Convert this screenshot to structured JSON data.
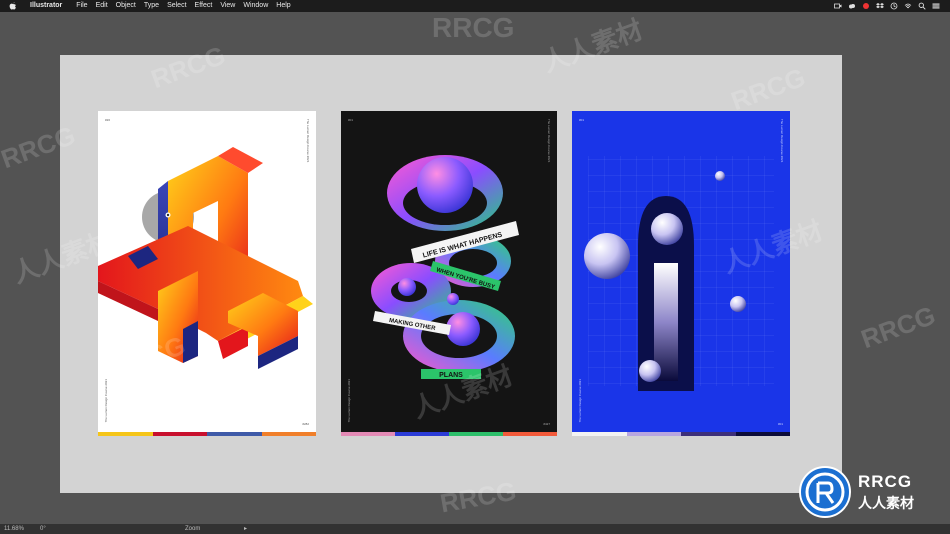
{
  "menubar": {
    "app": "Illustrator",
    "items": [
      "File",
      "Edit",
      "Object",
      "Type",
      "Select",
      "Effect",
      "View",
      "Window",
      "Help"
    ]
  },
  "posters": [
    {
      "number": "#26",
      "number_bottom": "#282",
      "side_text": "The Lumen Design Course 2021",
      "strip_colors": [
        "#f5c518",
        "#c8102e",
        "#3e5aa8",
        "#f07f2a"
      ]
    },
    {
      "number": "#01",
      "number_bottom": "#427",
      "side_text": "The Lumen Design Course 2021",
      "lines": [
        "LIFE IS WHAT HAPPENS",
        "WHEN YOU'RE BUSY",
        "MAKING OTHER",
        "PLANS"
      ],
      "strip_colors": [
        "#e38ab5",
        "#2a3bd6",
        "#2dbf6a",
        "#f25a3a"
      ]
    },
    {
      "number": "#01",
      "number_bottom": "#01",
      "side_text": "The Lumen Design Course 2021",
      "strip_colors": [
        "#f2f2f2",
        "#b7a6e0",
        "#3d2f7a",
        "#0c0c3a"
      ]
    }
  ],
  "statusbar": {
    "zoom": "11.68%",
    "rotation": "0°",
    "tool": "Zoom"
  },
  "watermark": {
    "text_en": "RRCG",
    "text_cn": "人人素材"
  }
}
